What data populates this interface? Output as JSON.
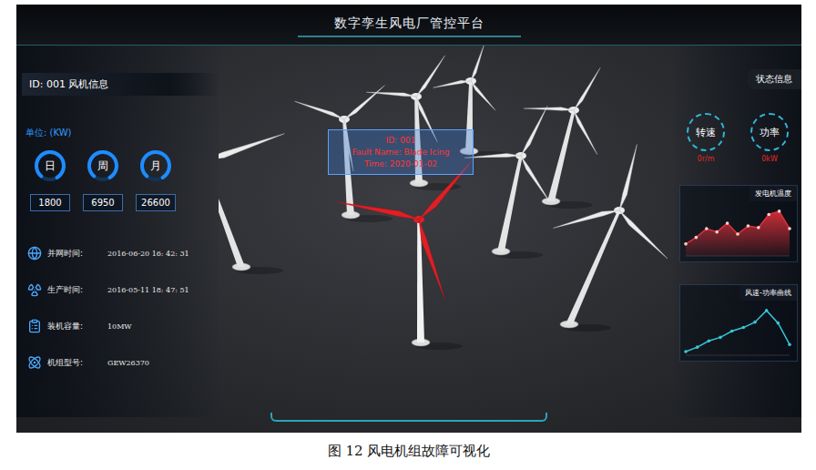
{
  "page": {
    "title": "数字孪生风电厂管控平台",
    "caption": "图 12 风电机组故障可视化"
  },
  "left_panel": {
    "title": "ID: 001 风机信息",
    "unit": "单位: (KW)",
    "gauges": [
      {
        "label": "日",
        "value": "1800",
        "level": 0.8
      },
      {
        "label": "周",
        "value": "6950",
        "level": 0.8
      },
      {
        "label": "月",
        "value": "26600",
        "level": 0.8
      }
    ],
    "details": [
      {
        "label": "并网时间:",
        "value": "2016-06-20 16: 42: 31"
      },
      {
        "label": "生产时间:",
        "value": "2016-05-11 18: 47: 51"
      },
      {
        "label": "装机容量:",
        "value": "10MW"
      },
      {
        "label": "机组型号:",
        "value": "GEW26370"
      }
    ]
  },
  "right_panel": {
    "title": "状态信息",
    "status": [
      {
        "label": "转速",
        "value": "0r/m"
      },
      {
        "label": "功率",
        "value": "0kW"
      }
    ],
    "charts": [
      {
        "title": "发电机温度",
        "kind": "area",
        "color": "#e0303a",
        "values": [
          22,
          34,
          50,
          44,
          60,
          40,
          55,
          52,
          76,
          82,
          50
        ]
      },
      {
        "title": "风速-功率曲线",
        "kind": "line",
        "color": "#35c6d6",
        "values": [
          4,
          9,
          16,
          20,
          27,
          31,
          37,
          50,
          36,
          12
        ]
      }
    ]
  },
  "tooltip": {
    "lines": [
      "ID: 001",
      "Fault Name: Blade Icing",
      "Time: 2020-01-02"
    ]
  },
  "turbines": [
    {
      "fault": false
    },
    {
      "fault": false
    },
    {
      "fault": false
    },
    {
      "fault": false
    },
    {
      "fault": true
    },
    {
      "fault": false
    },
    {
      "fault": false
    },
    {
      "fault": false
    }
  ]
}
